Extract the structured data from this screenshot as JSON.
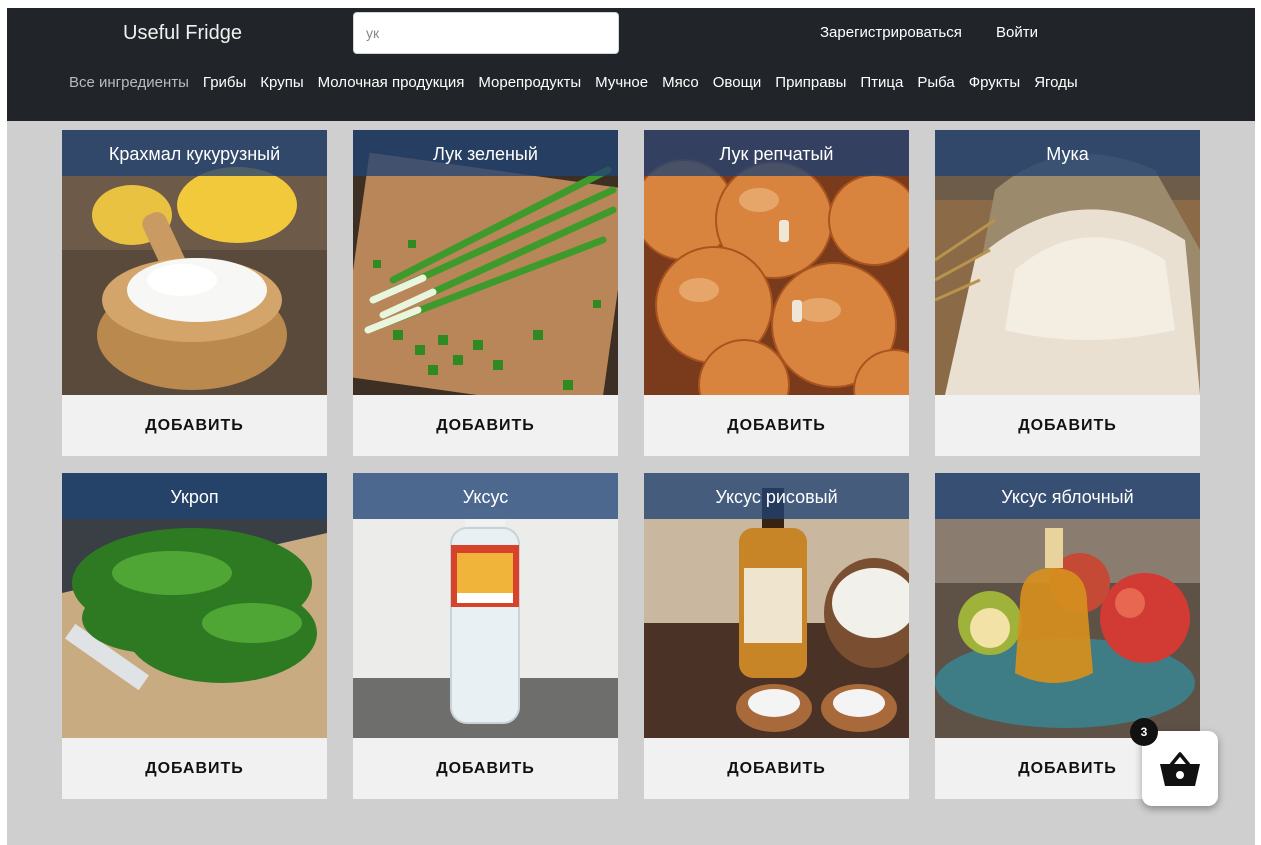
{
  "header": {
    "logo": "Useful Fridge",
    "search_value": "ук",
    "register_label": "Зарегистрироваться",
    "login_label": "Войти"
  },
  "categories": [
    "Все ингредиенты",
    "Грибы",
    "Крупы",
    "Молочная продукция",
    "Морепродукты",
    "Мучное",
    "Мясо",
    "Овощи",
    "Приправы",
    "Птица",
    "Рыба",
    "Фрукты",
    "Ягоды"
  ],
  "active_category": "Все ингредиенты",
  "products": [
    {
      "title": "Крахмал кукурузный",
      "add_label": "ДОБАВИТЬ",
      "photo": "corn-starch-photo"
    },
    {
      "title": "Лук зеленый",
      "add_label": "ДОБАВИТЬ",
      "photo": "green-onion-photo"
    },
    {
      "title": "Лук репчатый",
      "add_label": "ДОБАВИТЬ",
      "photo": "onion-photo"
    },
    {
      "title": "Мука",
      "add_label": "ДОБАВИТЬ",
      "photo": "flour-photo"
    },
    {
      "title": "Укроп",
      "add_label": "ДОБАВИТЬ",
      "photo": "dill-photo"
    },
    {
      "title": "Уксус",
      "add_label": "ДОБАВИТЬ",
      "photo": "vinegar-photo"
    },
    {
      "title": "Уксус рисовый",
      "add_label": "ДОБАВИТЬ",
      "photo": "rice-vinegar-photo"
    },
    {
      "title": "Уксус яблочный",
      "add_label": "ДОБАВИТЬ",
      "photo": "apple-vinegar-photo"
    }
  ],
  "cart": {
    "count": "3",
    "icon": "basket-icon"
  },
  "colors": {
    "header_bg": "#212529",
    "title_overlay": "#204273",
    "page_bg": "#cfcfcf",
    "card_bg": "#f1f1f1"
  }
}
